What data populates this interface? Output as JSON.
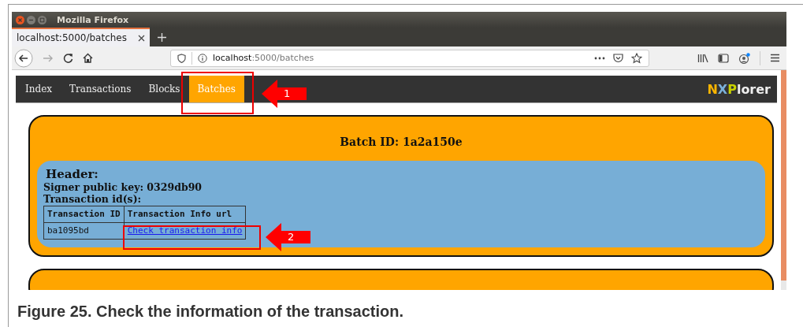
{
  "window": {
    "title": "Mozilla Firefox"
  },
  "tabs": [
    {
      "label": "localhost:5000/batches",
      "selected": true
    }
  ],
  "address_bar": {
    "host": "localhost",
    "path": ":5000/batches"
  },
  "nav": {
    "items": [
      {
        "label": "Index",
        "selected": false
      },
      {
        "label": "Transactions",
        "selected": false
      },
      {
        "label": "Blocks",
        "selected": false
      },
      {
        "label": "Batches",
        "selected": true
      }
    ],
    "logo": {
      "brand": "NXP",
      "rest": "lorer"
    }
  },
  "batch": {
    "title": "Batch ID: 1a2a150e",
    "header": {
      "heading": "Header:",
      "signer": "Signer public key: 0329db90",
      "ids_label": "Transaction id(s):",
      "columns": [
        "Transaction ID",
        "Transaction Info url"
      ],
      "rows": [
        {
          "id": "ba1095bd",
          "link": "Check transaction info"
        }
      ]
    }
  },
  "annotations": [
    {
      "label": "1"
    },
    {
      "label": "2"
    }
  ],
  "caption": "Figure 25.  Check the information of the transaction."
}
